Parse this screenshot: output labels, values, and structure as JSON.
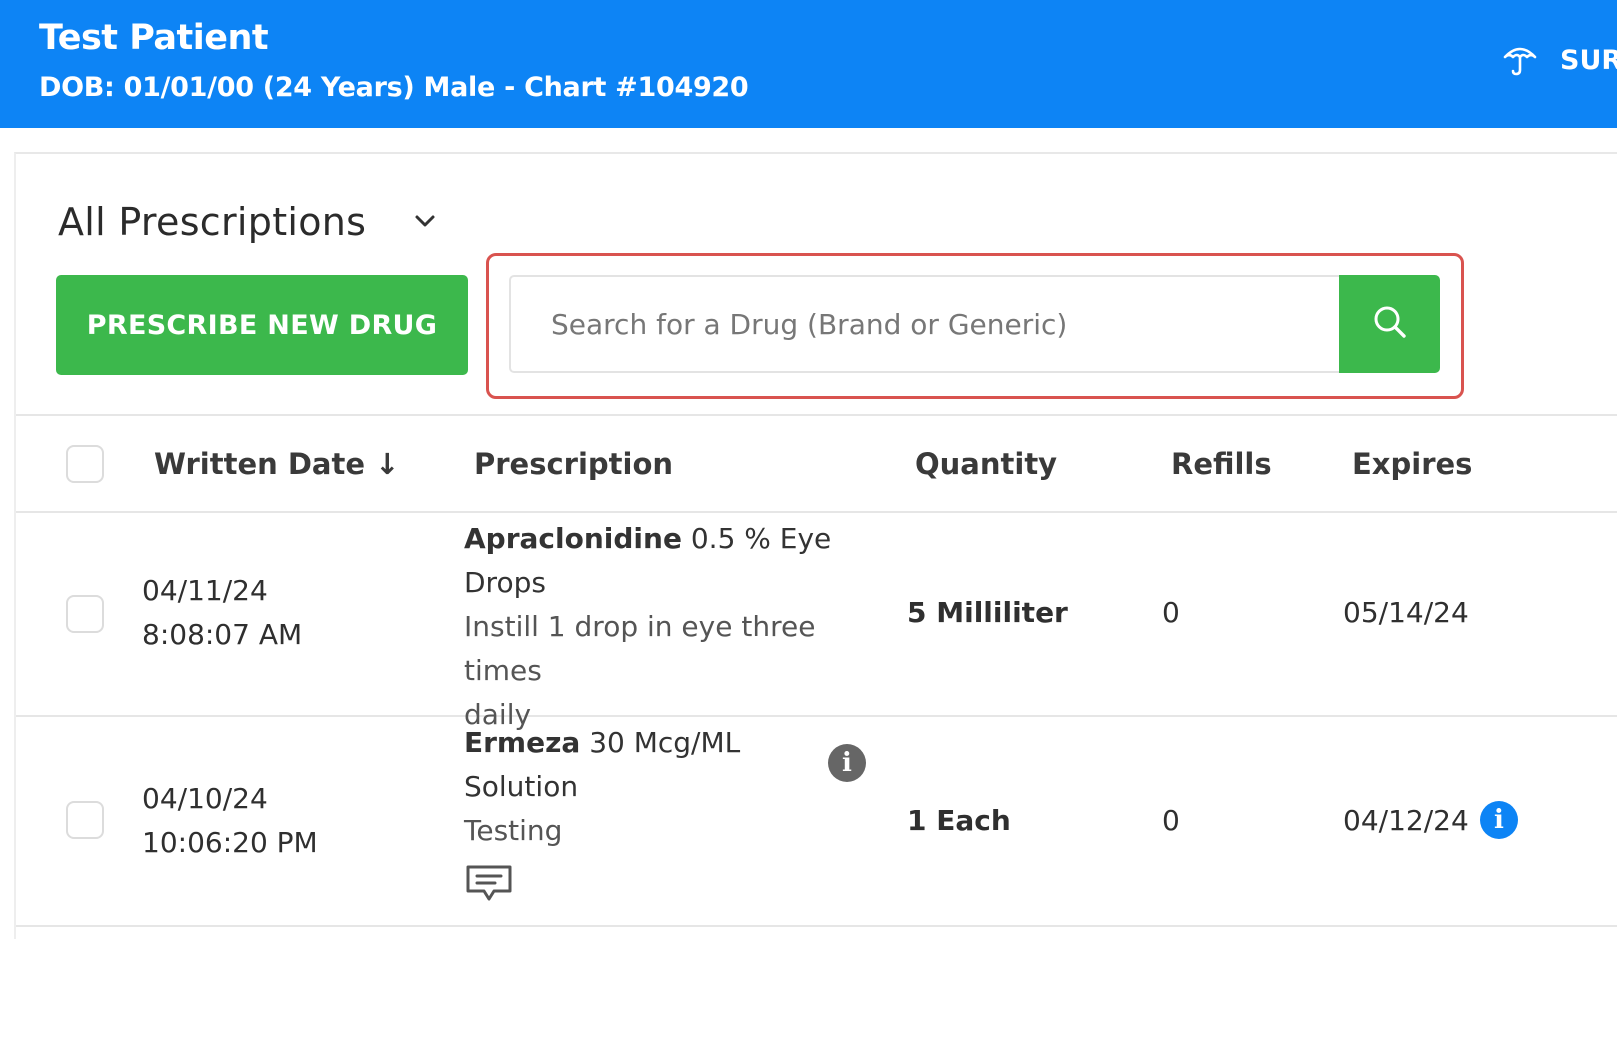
{
  "patient": {
    "name": "Test Patient",
    "details": "DOB: 01/01/00 (24 Years) Male - Chart #104920"
  },
  "header_right": {
    "label": "SUR",
    "icon": "umbrella-icon"
  },
  "view": {
    "title": "All Prescriptions",
    "icon": "chevron-down-icon"
  },
  "actions": {
    "prescribe_label": "PRESCRIBE NEW DRUG"
  },
  "search": {
    "placeholder": "Search for a Drug (Brand or Generic)",
    "value": "",
    "icon": "search-icon"
  },
  "table": {
    "columns": {
      "written_date": "Written Date",
      "sort_arrow": "↓",
      "prescription": "Prescription",
      "quantity": "Quantity",
      "refills": "Refills",
      "expires": "Expires"
    },
    "rows": [
      {
        "date": "04/11/24",
        "time": "8:08:07 AM",
        "drug_name": "Apraclonidine",
        "drug_line1_rest": " 0.5 % Eye",
        "drug_line2": "Drops",
        "sig_line1": "Instill 1 drop in eye three times",
        "sig_line2": "daily",
        "quantity": "5 Milliliter",
        "refills": "0",
        "expires": "05/14/24"
      },
      {
        "date": "04/10/24",
        "time": "10:06:20 PM",
        "drug_name": "Ermeza",
        "drug_line1_rest": " 30 Mcg/ML",
        "drug_line2": "Solution",
        "sig_line1": "Testing",
        "quantity": "1 Each",
        "refills": "0",
        "expires": "04/12/24",
        "info_glyph": "i",
        "icons": [
          "info-icon",
          "comment-icon",
          "info-icon"
        ]
      }
    ]
  },
  "colors": {
    "header_bg": "#0d84f5",
    "primary_green": "#3cb84c",
    "highlight_border": "#d9534f",
    "info_dark": "#666666",
    "info_blue": "#0d84f5"
  }
}
